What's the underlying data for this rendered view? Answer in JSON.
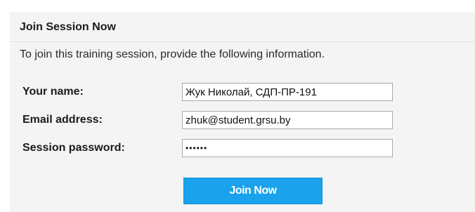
{
  "panel": {
    "title": "Join Session Now",
    "instructions": "To join this training session, provide the following information."
  },
  "form": {
    "name_label": "Your name:",
    "name_value": "Жук Николай, СДП-ПР-191",
    "email_label": "Email address:",
    "email_value": "zhuk@student.grsu.by",
    "password_label": "Session password:",
    "password_value": "••••••"
  },
  "actions": {
    "join_label": "Join Now"
  },
  "colors": {
    "panel_background": "#f4f4f4",
    "button_background": "#1aa3ec",
    "button_text": "#ffffff"
  }
}
